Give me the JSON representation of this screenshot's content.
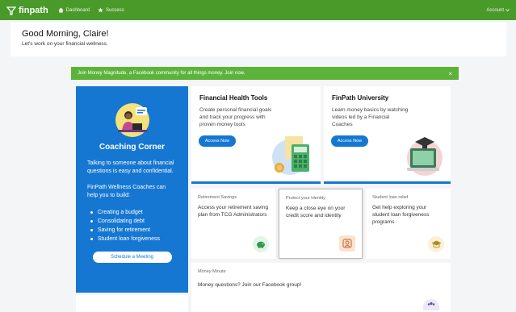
{
  "nav": {
    "brand": "finpath",
    "links": [
      {
        "label": "Dashboard",
        "icon": "home-icon"
      },
      {
        "label": "Success",
        "icon": "star-icon"
      }
    ],
    "account": "Account"
  },
  "greeting": {
    "title": "Good Morning, Claire!",
    "subtitle": "Let's work on your financial wellness."
  },
  "banner": {
    "text": "Join Money Magnitude, a Facebook community for all things money. Join now.",
    "close": "×"
  },
  "coaching": {
    "title": "Coaching Corner",
    "intro": "Talking to someone about financial questions is easy and confidential.",
    "help": "FinPath Wellness Coaches can help you to build:",
    "items": [
      "Creating a budget",
      "Consolidating debt",
      "Saving for retirement",
      "Student loan forgiveness"
    ],
    "button": "Schedule a Meeting"
  },
  "tools": {
    "health": {
      "title": "Financial Health Tools",
      "desc": "Create personal financial goals and track your progress with proven money tools",
      "button": "Access Now"
    },
    "university": {
      "title": "FinPath University",
      "desc": "Learn money basics by watching videos led by a Financial Coaches",
      "button": "Access Now"
    }
  },
  "cards": [
    {
      "label": "Retirement Savings",
      "desc": "Access your retirement saving plan from TCG Administrators"
    },
    {
      "label": "Protect your Identity",
      "desc": "Keep a close eye on your credit score and identity"
    },
    {
      "label": "Student loan relief",
      "desc": "Get help exploring your student loan forgiveness programs"
    }
  ],
  "money_minute": {
    "label": "Money Minute",
    "desc": "Money questions? Join our Facebook group!"
  },
  "colors": {
    "nav_green": "#4a9a2a",
    "banner_green": "#5cb33a",
    "primary_blue": "#1677d2"
  }
}
